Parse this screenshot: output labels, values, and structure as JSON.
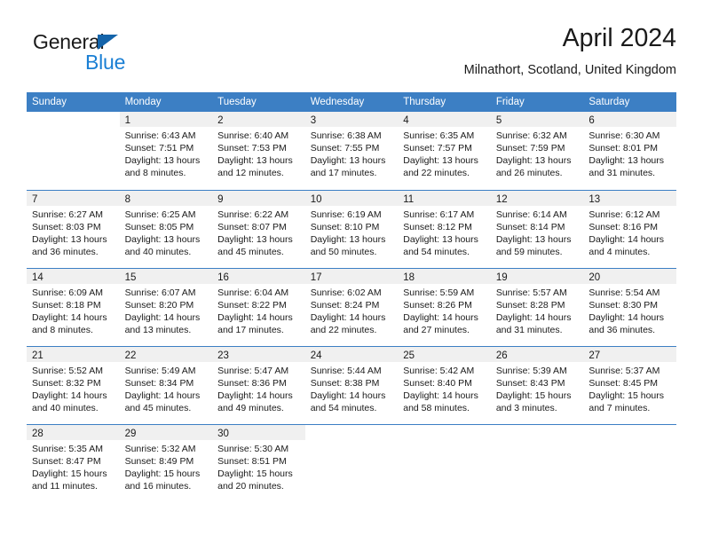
{
  "logo": {
    "primary_text": "General",
    "secondary_text": "Blue",
    "primary_color": "#1a1a1a",
    "secondary_color": "#1a7fd4",
    "triangle_color": "#1464aa"
  },
  "header": {
    "month_year": "April 2024",
    "location": "Milnathort, Scotland, United Kingdom"
  },
  "theme": {
    "header_band_color": "#3c7fc4",
    "day_band_color": "#f0f0f0",
    "text_color": "#1a1a1a"
  },
  "weekdays": [
    "Sunday",
    "Monday",
    "Tuesday",
    "Wednesday",
    "Thursday",
    "Friday",
    "Saturday"
  ],
  "weeks": [
    {
      "days": [
        {
          "number": "",
          "empty": true
        },
        {
          "number": "1",
          "sunrise": "Sunrise: 6:43 AM",
          "sunset": "Sunset: 7:51 PM",
          "daylight_line1": "Daylight: 13 hours",
          "daylight_line2": "and 8 minutes."
        },
        {
          "number": "2",
          "sunrise": "Sunrise: 6:40 AM",
          "sunset": "Sunset: 7:53 PM",
          "daylight_line1": "Daylight: 13 hours",
          "daylight_line2": "and 12 minutes."
        },
        {
          "number": "3",
          "sunrise": "Sunrise: 6:38 AM",
          "sunset": "Sunset: 7:55 PM",
          "daylight_line1": "Daylight: 13 hours",
          "daylight_line2": "and 17 minutes."
        },
        {
          "number": "4",
          "sunrise": "Sunrise: 6:35 AM",
          "sunset": "Sunset: 7:57 PM",
          "daylight_line1": "Daylight: 13 hours",
          "daylight_line2": "and 22 minutes."
        },
        {
          "number": "5",
          "sunrise": "Sunrise: 6:32 AM",
          "sunset": "Sunset: 7:59 PM",
          "daylight_line1": "Daylight: 13 hours",
          "daylight_line2": "and 26 minutes."
        },
        {
          "number": "6",
          "sunrise": "Sunrise: 6:30 AM",
          "sunset": "Sunset: 8:01 PM",
          "daylight_line1": "Daylight: 13 hours",
          "daylight_line2": "and 31 minutes."
        }
      ]
    },
    {
      "days": [
        {
          "number": "7",
          "sunrise": "Sunrise: 6:27 AM",
          "sunset": "Sunset: 8:03 PM",
          "daylight_line1": "Daylight: 13 hours",
          "daylight_line2": "and 36 minutes."
        },
        {
          "number": "8",
          "sunrise": "Sunrise: 6:25 AM",
          "sunset": "Sunset: 8:05 PM",
          "daylight_line1": "Daylight: 13 hours",
          "daylight_line2": "and 40 minutes."
        },
        {
          "number": "9",
          "sunrise": "Sunrise: 6:22 AM",
          "sunset": "Sunset: 8:07 PM",
          "daylight_line1": "Daylight: 13 hours",
          "daylight_line2": "and 45 minutes."
        },
        {
          "number": "10",
          "sunrise": "Sunrise: 6:19 AM",
          "sunset": "Sunset: 8:10 PM",
          "daylight_line1": "Daylight: 13 hours",
          "daylight_line2": "and 50 minutes."
        },
        {
          "number": "11",
          "sunrise": "Sunrise: 6:17 AM",
          "sunset": "Sunset: 8:12 PM",
          "daylight_line1": "Daylight: 13 hours",
          "daylight_line2": "and 54 minutes."
        },
        {
          "number": "12",
          "sunrise": "Sunrise: 6:14 AM",
          "sunset": "Sunset: 8:14 PM",
          "daylight_line1": "Daylight: 13 hours",
          "daylight_line2": "and 59 minutes."
        },
        {
          "number": "13",
          "sunrise": "Sunrise: 6:12 AM",
          "sunset": "Sunset: 8:16 PM",
          "daylight_line1": "Daylight: 14 hours",
          "daylight_line2": "and 4 minutes."
        }
      ]
    },
    {
      "days": [
        {
          "number": "14",
          "sunrise": "Sunrise: 6:09 AM",
          "sunset": "Sunset: 8:18 PM",
          "daylight_line1": "Daylight: 14 hours",
          "daylight_line2": "and 8 minutes."
        },
        {
          "number": "15",
          "sunrise": "Sunrise: 6:07 AM",
          "sunset": "Sunset: 8:20 PM",
          "daylight_line1": "Daylight: 14 hours",
          "daylight_line2": "and 13 minutes."
        },
        {
          "number": "16",
          "sunrise": "Sunrise: 6:04 AM",
          "sunset": "Sunset: 8:22 PM",
          "daylight_line1": "Daylight: 14 hours",
          "daylight_line2": "and 17 minutes."
        },
        {
          "number": "17",
          "sunrise": "Sunrise: 6:02 AM",
          "sunset": "Sunset: 8:24 PM",
          "daylight_line1": "Daylight: 14 hours",
          "daylight_line2": "and 22 minutes."
        },
        {
          "number": "18",
          "sunrise": "Sunrise: 5:59 AM",
          "sunset": "Sunset: 8:26 PM",
          "daylight_line1": "Daylight: 14 hours",
          "daylight_line2": "and 27 minutes."
        },
        {
          "number": "19",
          "sunrise": "Sunrise: 5:57 AM",
          "sunset": "Sunset: 8:28 PM",
          "daylight_line1": "Daylight: 14 hours",
          "daylight_line2": "and 31 minutes."
        },
        {
          "number": "20",
          "sunrise": "Sunrise: 5:54 AM",
          "sunset": "Sunset: 8:30 PM",
          "daylight_line1": "Daylight: 14 hours",
          "daylight_line2": "and 36 minutes."
        }
      ]
    },
    {
      "days": [
        {
          "number": "21",
          "sunrise": "Sunrise: 5:52 AM",
          "sunset": "Sunset: 8:32 PM",
          "daylight_line1": "Daylight: 14 hours",
          "daylight_line2": "and 40 minutes."
        },
        {
          "number": "22",
          "sunrise": "Sunrise: 5:49 AM",
          "sunset": "Sunset: 8:34 PM",
          "daylight_line1": "Daylight: 14 hours",
          "daylight_line2": "and 45 minutes."
        },
        {
          "number": "23",
          "sunrise": "Sunrise: 5:47 AM",
          "sunset": "Sunset: 8:36 PM",
          "daylight_line1": "Daylight: 14 hours",
          "daylight_line2": "and 49 minutes."
        },
        {
          "number": "24",
          "sunrise": "Sunrise: 5:44 AM",
          "sunset": "Sunset: 8:38 PM",
          "daylight_line1": "Daylight: 14 hours",
          "daylight_line2": "and 54 minutes."
        },
        {
          "number": "25",
          "sunrise": "Sunrise: 5:42 AM",
          "sunset": "Sunset: 8:40 PM",
          "daylight_line1": "Daylight: 14 hours",
          "daylight_line2": "and 58 minutes."
        },
        {
          "number": "26",
          "sunrise": "Sunrise: 5:39 AM",
          "sunset": "Sunset: 8:43 PM",
          "daylight_line1": "Daylight: 15 hours",
          "daylight_line2": "and 3 minutes."
        },
        {
          "number": "27",
          "sunrise": "Sunrise: 5:37 AM",
          "sunset": "Sunset: 8:45 PM",
          "daylight_line1": "Daylight: 15 hours",
          "daylight_line2": "and 7 minutes."
        }
      ]
    },
    {
      "days": [
        {
          "number": "28",
          "sunrise": "Sunrise: 5:35 AM",
          "sunset": "Sunset: 8:47 PM",
          "daylight_line1": "Daylight: 15 hours",
          "daylight_line2": "and 11 minutes."
        },
        {
          "number": "29",
          "sunrise": "Sunrise: 5:32 AM",
          "sunset": "Sunset: 8:49 PM",
          "daylight_line1": "Daylight: 15 hours",
          "daylight_line2": "and 16 minutes."
        },
        {
          "number": "30",
          "sunrise": "Sunrise: 5:30 AM",
          "sunset": "Sunset: 8:51 PM",
          "daylight_line1": "Daylight: 15 hours",
          "daylight_line2": "and 20 minutes."
        },
        {
          "number": "",
          "empty": true
        },
        {
          "number": "",
          "empty": true
        },
        {
          "number": "",
          "empty": true
        },
        {
          "number": "",
          "empty": true
        }
      ]
    }
  ]
}
